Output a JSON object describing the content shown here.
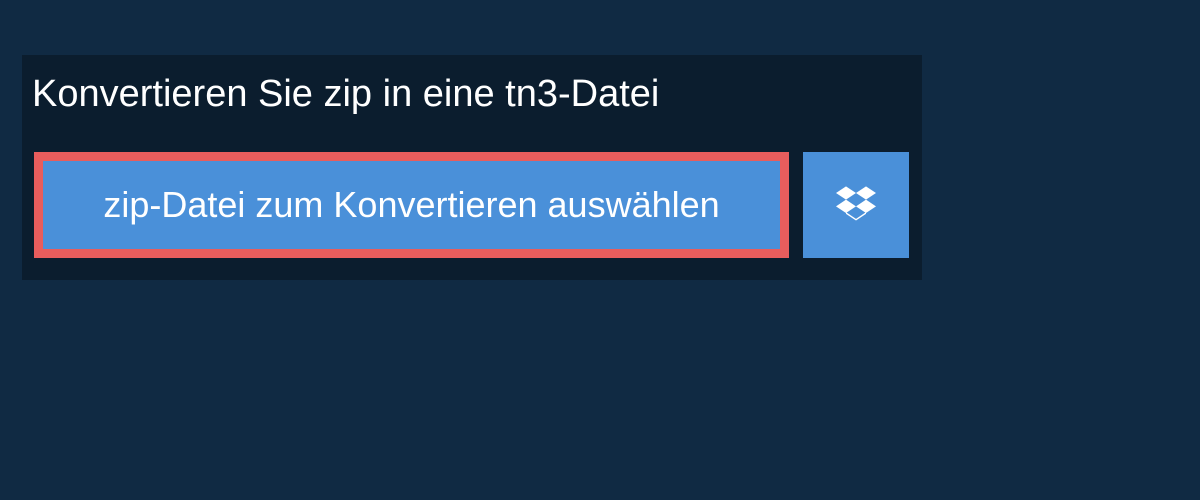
{
  "header": {
    "title": "Konvertieren Sie zip in eine tn3-Datei"
  },
  "actions": {
    "select_file_label": "zip-Datei zum Konvertieren auswählen",
    "dropbox_icon": "dropbox-icon"
  },
  "colors": {
    "background": "#102a43",
    "panel": "#0b1d2e",
    "button": "#4a90d9",
    "highlight_border": "#e85d5d",
    "text": "#ffffff"
  }
}
